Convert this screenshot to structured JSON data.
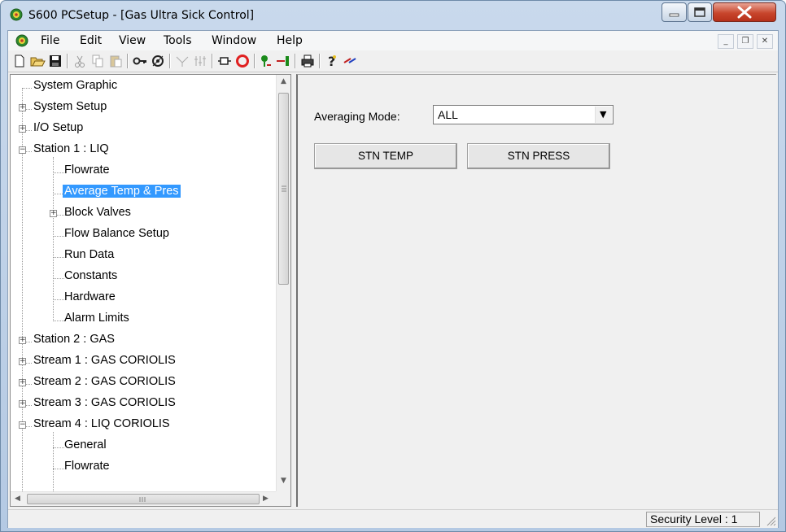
{
  "window": {
    "title": "S600 PCSetup  - [Gas Ultra Sick Control]"
  },
  "menubar": {
    "items": [
      "File",
      "Edit",
      "View",
      "Tools",
      "Window",
      "Help"
    ]
  },
  "toolbar": {
    "tools": [
      "new-file-icon",
      "open-folder-icon",
      "save-icon",
      "cut-icon",
      "copy-icon",
      "paste-icon",
      "key-icon",
      "security-icon",
      "compare-icon",
      "config-icon",
      "connect-icon",
      "disconnect-icon",
      "receive-icon",
      "send-icon",
      "print-icon",
      "help-icon",
      "transfer-icon"
    ]
  },
  "tree": {
    "items": [
      {
        "label": "System Graphic",
        "level": 0,
        "expander": "none"
      },
      {
        "label": "System Setup",
        "level": 0,
        "expander": "plus"
      },
      {
        "label": "I/O Setup",
        "level": 0,
        "expander": "plus"
      },
      {
        "label": "Station 1 : LIQ",
        "level": 0,
        "expander": "minus"
      },
      {
        "label": "Flowrate",
        "level": 1,
        "expander": "none"
      },
      {
        "label": "Average Temp & Pres",
        "level": 1,
        "expander": "none",
        "selected": true
      },
      {
        "label": "Block Valves",
        "level": 1,
        "expander": "plus"
      },
      {
        "label": "Flow Balance Setup",
        "level": 1,
        "expander": "none"
      },
      {
        "label": "Run Data",
        "level": 1,
        "expander": "none"
      },
      {
        "label": "Constants",
        "level": 1,
        "expander": "none"
      },
      {
        "label": "Hardware",
        "level": 1,
        "expander": "none"
      },
      {
        "label": "Alarm Limits",
        "level": 1,
        "expander": "none"
      },
      {
        "label": "Station 2 : GAS",
        "level": 0,
        "expander": "plus"
      },
      {
        "label": "Stream 1 : GAS CORIOLIS",
        "level": 0,
        "expander": "plus"
      },
      {
        "label": "Stream 2 : GAS CORIOLIS",
        "level": 0,
        "expander": "plus"
      },
      {
        "label": "Stream 3 : GAS CORIOLIS",
        "level": 0,
        "expander": "plus"
      },
      {
        "label": "Stream 4 : LIQ CORIOLIS",
        "level": 0,
        "expander": "minus"
      },
      {
        "label": "General",
        "level": 1,
        "expander": "none"
      },
      {
        "label": "Flowrate",
        "level": 1,
        "expander": "none"
      }
    ]
  },
  "panel": {
    "averaging_label": "Averaging Mode:",
    "averaging_value": "ALL",
    "stn_temp_label": "STN TEMP",
    "stn_press_label": "STN PRESS"
  },
  "status": {
    "security": "Security Level : 1"
  }
}
